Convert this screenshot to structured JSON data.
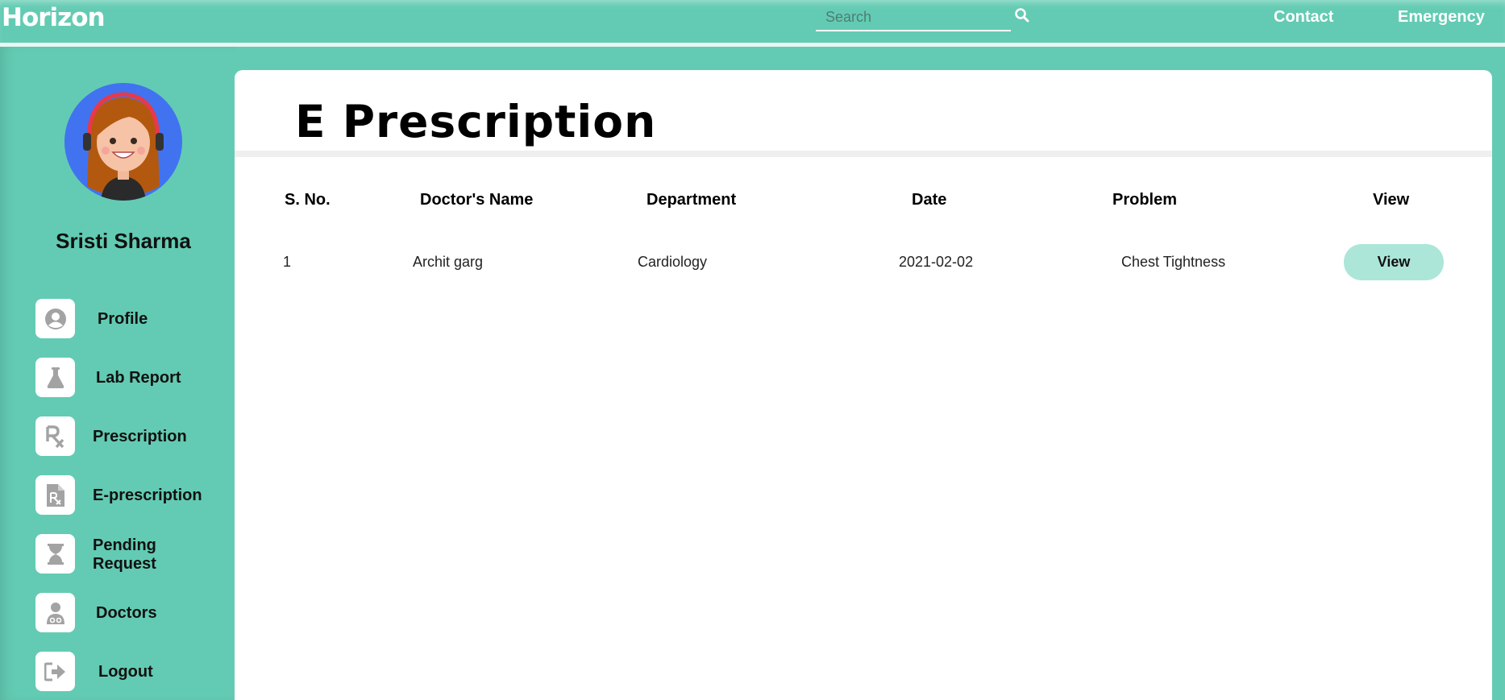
{
  "header": {
    "brand": "Horizon",
    "search": {
      "placeholder": "Search",
      "value": ""
    },
    "nav": {
      "contact": "Contact",
      "emergency": "Emergency"
    }
  },
  "user": {
    "name": "Sristi Sharma"
  },
  "sidebar": {
    "items": [
      {
        "label": "Profile",
        "icon": "user-circle-icon"
      },
      {
        "label": "Lab Report",
        "icon": "flask-icon"
      },
      {
        "label": "Prescription",
        "icon": "rx-icon"
      },
      {
        "label": "E-prescription",
        "icon": "file-rx-icon"
      },
      {
        "label": "Pending Request",
        "icon": "hourglass-icon"
      },
      {
        "label": "Doctors",
        "icon": "doctor-icon"
      },
      {
        "label": "Logout",
        "icon": "logout-icon"
      }
    ]
  },
  "main": {
    "title": "E Prescription",
    "table": {
      "columns": [
        "S. No.",
        "Doctor's Name",
        "Department",
        "Date",
        "Problem",
        "View"
      ],
      "rows": [
        {
          "sno": "1",
          "doctor": "Archit garg",
          "department": "Cardiology",
          "date": "2021-02-02",
          "problem": "Chest Tightness",
          "view_label": "View"
        }
      ]
    }
  },
  "colors": {
    "brand_bg": "#63cbb3",
    "panel_bg": "#ffffff",
    "view_button_bg": "#ace6d8",
    "avatar_bg": "#4173f0",
    "icon_gray": "#a3a3a3"
  }
}
